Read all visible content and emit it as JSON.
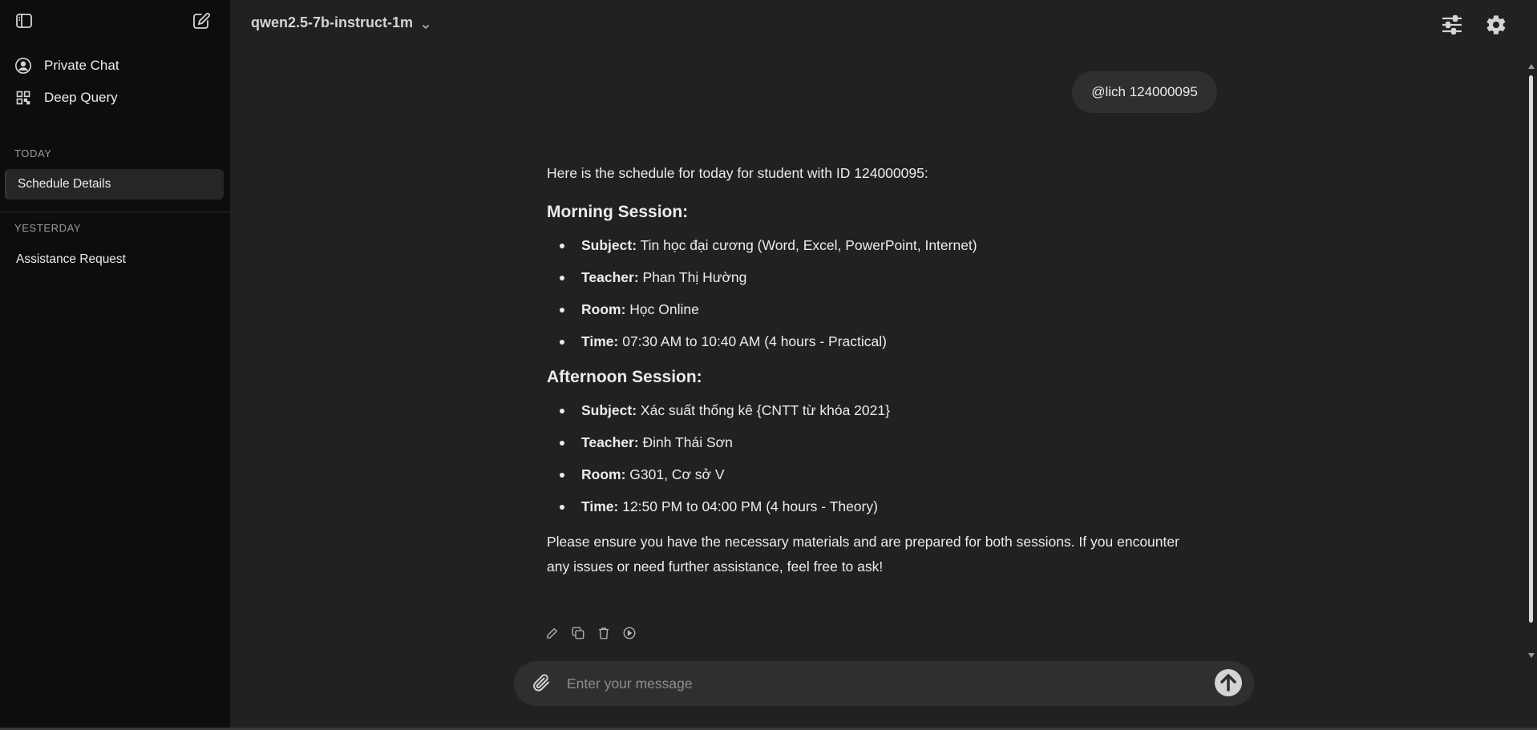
{
  "sidebar": {
    "nav": [
      {
        "label": "Private Chat",
        "icon": "user-circle-icon"
      },
      {
        "label": "Deep Query",
        "icon": "qr-grid-icon"
      }
    ],
    "sections": [
      {
        "title": "TODAY",
        "chats": [
          {
            "label": "Schedule Details",
            "active": true
          }
        ]
      },
      {
        "title": "YESTERDAY",
        "chats": [
          {
            "label": "Assistance Request",
            "active": false
          }
        ]
      }
    ]
  },
  "header": {
    "model": "qwen2.5-7b-instruct-1m",
    "icons": [
      "sliders-icon",
      "gear-icon"
    ]
  },
  "conversation": {
    "user_message": "@lich 124000095",
    "assistant": {
      "intro": "Here is the schedule for today for student with ID 124000095:",
      "sessions": [
        {
          "heading": "Morning Session:",
          "items": [
            {
              "key": "Subject:",
              "value": " Tin học đại cương (Word, Excel, PowerPoint, Internet)"
            },
            {
              "key": "Teacher:",
              "value": " Phan Thị Hường"
            },
            {
              "key": "Room:",
              "value": " Học Online"
            },
            {
              "key": "Time:",
              "value": " 07:30 AM to 10:40 AM (4 hours - Practical)"
            }
          ]
        },
        {
          "heading": "Afternoon Session:",
          "items": [
            {
              "key": "Subject:",
              "value": " Xác suất thống kê {CNTT từ khóa 2021}"
            },
            {
              "key": "Teacher:",
              "value": " Đinh Thái Sơn"
            },
            {
              "key": "Room:",
              "value": " G301, Cơ sở V"
            },
            {
              "key": "Time:",
              "value": " 12:50 PM to 04:00 PM (4 hours - Theory)"
            }
          ]
        }
      ],
      "closing_line1": "Please ensure you have the necessary materials and are prepared for both sessions. If you encounter",
      "closing_line2": "any issues or need further assistance, feel free to ask!"
    },
    "actions": [
      "edit-icon",
      "copy-icon",
      "delete-icon",
      "play-icon"
    ]
  },
  "composer": {
    "placeholder": "Enter your message"
  },
  "colors": {
    "background": "#212121",
    "sidebar": "#0d0d0d",
    "bubble": "#2f2f2f",
    "text": "#ececec",
    "muted": "#9b9b9b"
  }
}
